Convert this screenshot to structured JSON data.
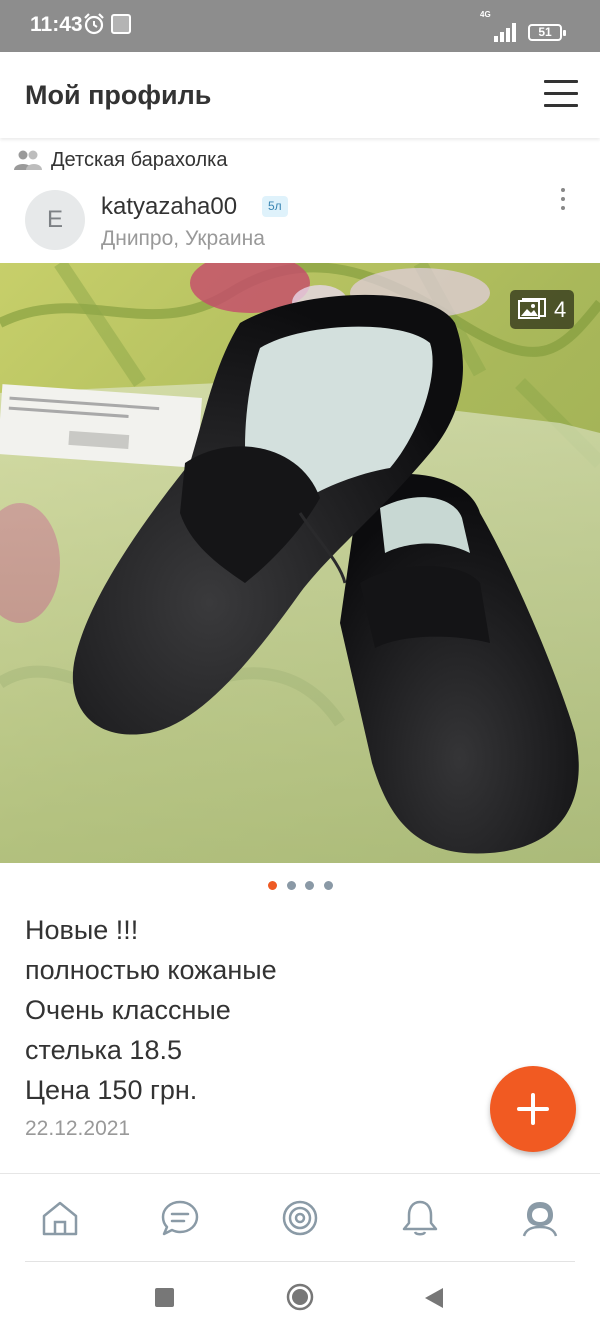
{
  "status_bar": {
    "time": "11:43",
    "network": "4G",
    "battery": "51",
    "icons": [
      "alarm-icon",
      "app-icon",
      "signal-icon",
      "battery-icon"
    ]
  },
  "header": {
    "title": "Мой профиль",
    "menu_icon": "hamburger-menu-icon"
  },
  "group": {
    "icon": "group-icon",
    "name": "Детская барахолка"
  },
  "author": {
    "avatar_letter": "E",
    "username": "katyazaha00",
    "badge": "5л",
    "location": "Днипро, Украина",
    "more_icon": "more-vertical-icon"
  },
  "photo": {
    "icon": "gallery-icon",
    "count": "4",
    "pager": {
      "total": 4,
      "active": 1
    }
  },
  "post": {
    "lines": [
      "Новые !!!",
      "полностью кожаные",
      "Очень классные",
      "стелька 18.5",
      "Цена 150 грн."
    ],
    "date": "22.12.2021"
  },
  "fab": {
    "icon": "plus-icon"
  },
  "bottom_nav": {
    "items": [
      {
        "name": "home",
        "icon": "home-icon"
      },
      {
        "name": "messages",
        "icon": "chat-icon"
      },
      {
        "name": "target",
        "icon": "target-icon"
      },
      {
        "name": "notifications",
        "icon": "bell-icon"
      },
      {
        "name": "profile",
        "icon": "profile-icon"
      }
    ]
  },
  "colors": {
    "accent": "#f15a22",
    "status_bar": "#8d8d8d",
    "text": "#333333",
    "muted": "#999999"
  }
}
